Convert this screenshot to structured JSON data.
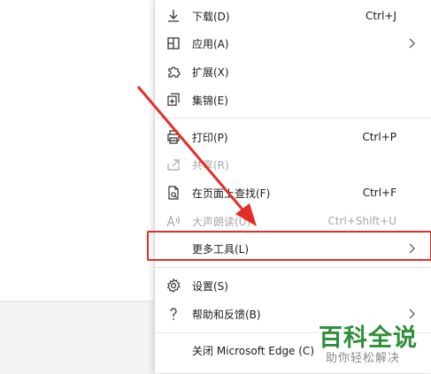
{
  "menu": {
    "items": [
      {
        "icon": "download-icon",
        "label": "下载(D)",
        "shortcut": "Ctrl+J"
      },
      {
        "icon": "apps-icon",
        "label": "应用(A)",
        "submenu": true
      },
      {
        "icon": "extensions-icon",
        "label": "扩展(X)"
      },
      {
        "icon": "collections-icon",
        "label": "集锦(E)"
      },
      {
        "icon": "print-icon",
        "label": "打印(P)",
        "shortcut": "Ctrl+P"
      },
      {
        "icon": "share-icon",
        "label": "共享(R)",
        "disabled": true
      },
      {
        "icon": "find-icon",
        "label": "在页面上查找(F)",
        "shortcut": "Ctrl+F"
      },
      {
        "icon": "read-aloud-icon",
        "label": "大声朗读(U)",
        "shortcut": "Ctrl+Shift+U",
        "disabled": true
      },
      {
        "icon": "more-tools-icon",
        "label": "更多工具(L)",
        "submenu": true,
        "highlighted": true
      },
      {
        "icon": "settings-icon",
        "label": "设置(S)"
      },
      {
        "icon": "help-icon",
        "label": "帮助和反馈(B)",
        "submenu": true
      },
      {
        "icon": "",
        "label": "关闭 Microsoft Edge (C)"
      }
    ]
  },
  "watermark": {
    "title": "百科全说",
    "subtitle": "助你轻松解决"
  },
  "colors": {
    "annotation": "#e52d27",
    "watermark": "#2f8f3a",
    "disabled_text": "#a6a6a6"
  }
}
